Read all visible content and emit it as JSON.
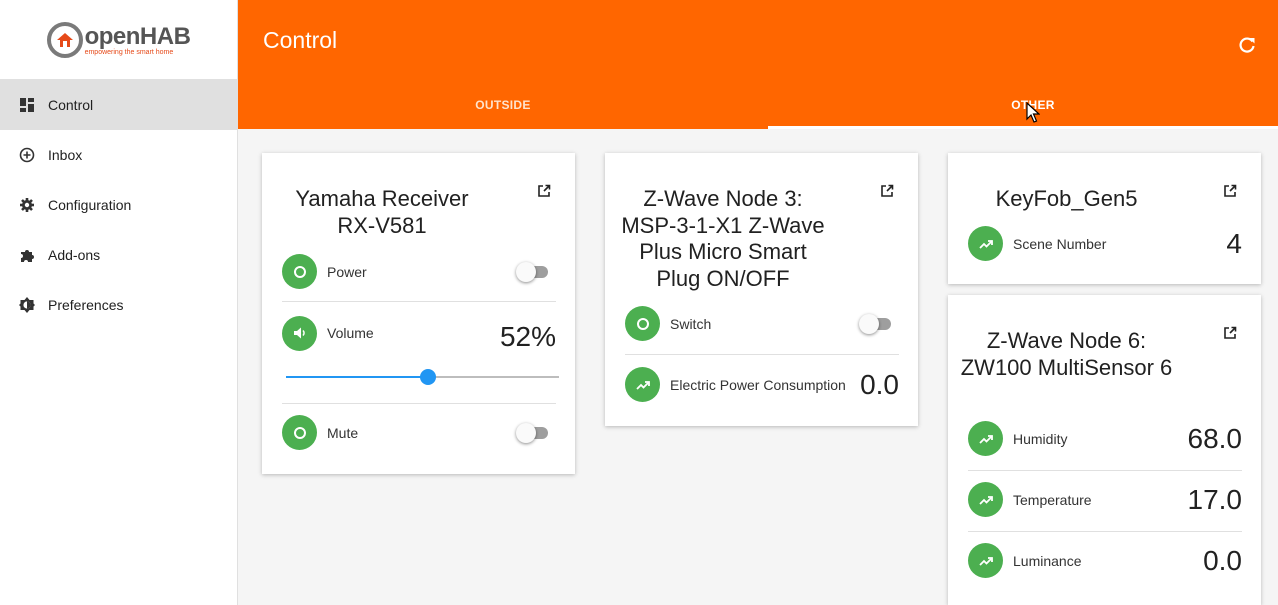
{
  "app": {
    "logo_name": "openHAB",
    "logo_tagline": "empowering the smart home",
    "brand_color": "#ff6600",
    "accent_green": "#4caf50",
    "slider_blue": "#2196f3"
  },
  "sidebar": {
    "items": [
      {
        "label": "Control",
        "icon": "dashboard-icon",
        "active": true
      },
      {
        "label": "Inbox",
        "icon": "add-circle-icon",
        "active": false
      },
      {
        "label": "Configuration",
        "icon": "gear-icon",
        "active": false
      },
      {
        "label": "Add-ons",
        "icon": "puzzle-icon",
        "active": false
      },
      {
        "label": "Preferences",
        "icon": "brightness-gear-icon",
        "active": false
      }
    ]
  },
  "header": {
    "title": "Control",
    "refresh_icon": "refresh-icon",
    "tabs": [
      {
        "label": "OUTSIDE",
        "selected": false
      },
      {
        "label": "OTHER",
        "selected": true
      }
    ]
  },
  "cards": {
    "yamaha": {
      "title": "Yamaha Receiver RX-V581",
      "power": {
        "label": "Power",
        "state": "off"
      },
      "volume": {
        "label": "Volume",
        "value": "52%",
        "level": 0.52
      },
      "mute": {
        "label": "Mute",
        "state": "off"
      }
    },
    "zwave3": {
      "title": "Z-Wave Node 3: MSP-3-1-X1 Z-Wave Plus Micro Smart Plug ON/OFF",
      "switch": {
        "label": "Switch",
        "state": "off"
      },
      "power": {
        "label": "Electric Power Consumption",
        "value": "0.0"
      }
    },
    "keyfob": {
      "title": "KeyFob_Gen5",
      "scene": {
        "label": "Scene Number",
        "value": "4"
      }
    },
    "zwave6": {
      "title": "Z-Wave Node 6: ZW100 MultiSensor 6",
      "humidity": {
        "label": "Humidity",
        "value": "68.0"
      },
      "temperature": {
        "label": "Temperature",
        "value": "17.0"
      },
      "luminance": {
        "label": "Luminance",
        "value": "0.0"
      }
    }
  }
}
